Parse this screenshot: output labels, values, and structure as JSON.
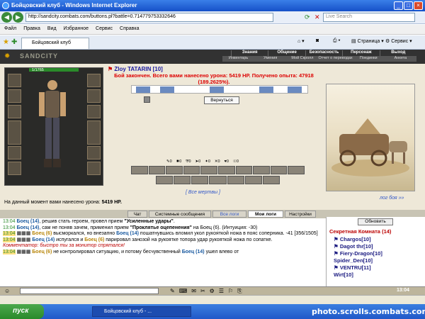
{
  "browser": {
    "window_title": "Бойцовский клуб - Windows Internet Explorer",
    "address": "http://sandcity.combats.com/buttons.pl?battle=0.714779753332646",
    "search_placeholder": "Live Search",
    "menu": [
      "Файл",
      "Правка",
      "Вид",
      "Избранное",
      "Сервис",
      "Справка"
    ],
    "tab_title": "Бойцовский клуб",
    "toolbar": {
      "page": "Страница",
      "tools": "Сервис"
    }
  },
  "game": {
    "logo": "SANDCITY",
    "nav": [
      "Знания",
      "Общение",
      "Безопасность",
      "Персонаж",
      "Выход"
    ],
    "subnav": [
      "Инвентарь",
      "Умения",
      "Мой Скролл",
      "Отчет о переводах",
      "Поединки",
      "Анкета"
    ],
    "hp": "1/1765",
    "player": "Zloy TATARIN [10]",
    "result": "Бой закончен. Всего вами нанесено урона: 5419 HP. Получено опыта: 47918 (189.2625%).",
    "back_button": "Вернуться",
    "counts": [
      "0",
      "0",
      "0",
      "0",
      "0",
      "0",
      "0",
      "0"
    ],
    "dead_link": "[ Все мертвы ]",
    "damage_label": "На данный момент вами нанесено урона:",
    "damage_value": "5419 HP.",
    "logs_link": "лог боя »»"
  },
  "logtabs": [
    "Чат",
    "Системные сообщения",
    "Все логи",
    "Мои логи",
    "Настройки"
  ],
  "chat": [
    {
      "time": "13:04",
      "actor": "Боец (14)",
      "text": ", решив стать героем, провел прием ",
      "bold": "\"Усиленные удары\"",
      "rest": "."
    },
    {
      "time": "13:04",
      "actor": "Боец (14)",
      "text": ", сам не поняв зачем, применил прием ",
      "bold": "\"Проклятье оцепенения\"",
      "rest": " на Боец (6). (Интуиция: -30)"
    },
    {
      "time": "13:04",
      "actor": "Боец (6)",
      "text": " высморкался, но внезапно ",
      "target": "Боец (14)",
      "rest": " пошатнувшись вломил укол рукояткой ножа в пояс соперника. -41 [356/1505]"
    },
    {
      "time": "13:04",
      "actor": "Боец (14)",
      "text": " испугался и ",
      "target": "Боец (6)",
      "rest": " парировал занозой на рукоятке топора удар рукояткой ножа по сопатке."
    },
    {
      "note": "Комментатор: быстро ты за монитор спрятался!"
    },
    {
      "time": "13:04",
      "actor": "Боец (6)",
      "text": " не контролировал ситуацию, и потому бесчувственный ",
      "target": "Боец (14)",
      "rest": " ушел влево от"
    }
  ],
  "room": {
    "refresh": "Обновить",
    "title": "Секретная Комната (14)",
    "users": [
      "Chargos[10]",
      "Dagot thr[10]",
      "Fiery-Dragon[10]",
      "Spider_Den[10]",
      "VENTRU[11]",
      "Wirt[10]"
    ]
  },
  "clock": "13:04",
  "taskbar": {
    "start": "пуск",
    "task": "Бойцовский клуб - ...",
    "watermark": "photo.scrolls.combats.com"
  }
}
